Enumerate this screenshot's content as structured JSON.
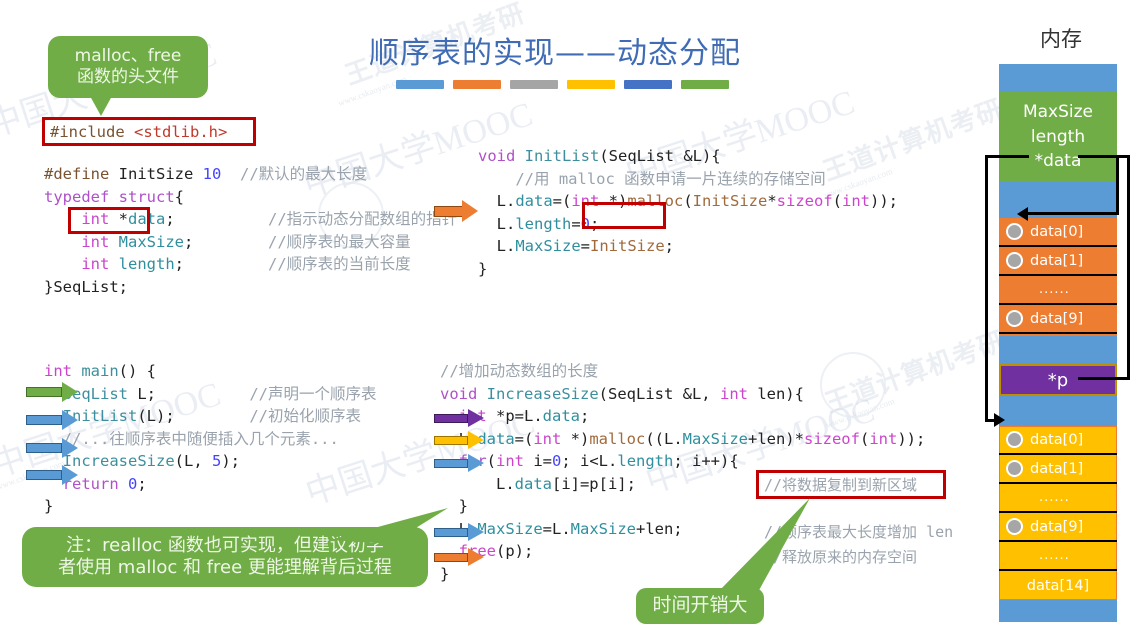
{
  "slide": {
    "title": "顺序表的实现——动态分配",
    "title_color": "#3f6cb4",
    "bar_colors": [
      "#5b9bd5",
      "#ed7d31",
      "#a5a5a5",
      "#ffc000",
      "#4472c4",
      "#70ad47"
    ]
  },
  "callouts": {
    "header_note": {
      "line1": "malloc、free",
      "line2": "函数的头文件"
    },
    "realloc_note": {
      "line1": "注：realloc 函数也可实现，但建议初学",
      "line2": "者使用 malloc 和 free 更能理解背后过程"
    },
    "time_cost": {
      "text": "时间开销大"
    }
  },
  "code": {
    "include": {
      "directive": "#include",
      "header": "<stdlib.h>"
    },
    "struct_block": [
      {
        "tokens": [
          {
            "t": "#define ",
            "c": "pp"
          },
          {
            "t": "InitSize ",
            "c": "pl"
          },
          {
            "t": "10",
            "c": "num"
          },
          {
            "t": "  ",
            "c": "pl"
          },
          {
            "t": "//默认的最大长度",
            "c": "cm"
          }
        ]
      },
      {
        "tokens": [
          {
            "t": "typedef",
            "c": "kw"
          },
          {
            "t": " ",
            "c": "pl"
          },
          {
            "t": "struct",
            "c": "kw"
          },
          {
            "t": "{",
            "c": "pl"
          }
        ]
      },
      {
        "tokens": [
          {
            "t": "    ",
            "c": "pl"
          },
          {
            "t": "int",
            "c": "kw2"
          },
          {
            "t": " *",
            "c": "pl"
          },
          {
            "t": "data",
            "c": "id"
          },
          {
            "t": ";",
            "c": "pl"
          },
          {
            "t": "          ",
            "c": "pl"
          },
          {
            "t": "//指示动态分配数组的指针",
            "c": "cm"
          }
        ]
      },
      {
        "tokens": [
          {
            "t": "    ",
            "c": "pl"
          },
          {
            "t": "int",
            "c": "kw2"
          },
          {
            "t": " ",
            "c": "pl"
          },
          {
            "t": "MaxSize",
            "c": "id"
          },
          {
            "t": ";",
            "c": "pl"
          },
          {
            "t": "        ",
            "c": "pl"
          },
          {
            "t": "//顺序表的最大容量",
            "c": "cm"
          }
        ]
      },
      {
        "tokens": [
          {
            "t": "    ",
            "c": "pl"
          },
          {
            "t": "int",
            "c": "kw2"
          },
          {
            "t": " ",
            "c": "pl"
          },
          {
            "t": "length",
            "c": "id"
          },
          {
            "t": ";",
            "c": "pl"
          },
          {
            "t": "         ",
            "c": "pl"
          },
          {
            "t": "//顺序表的当前长度",
            "c": "cm"
          }
        ]
      },
      {
        "tokens": [
          {
            "t": "}SeqList;",
            "c": "pl"
          }
        ]
      }
    ],
    "initlist_block": [
      {
        "tokens": [
          {
            "t": "void",
            "c": "kw"
          },
          {
            "t": " ",
            "c": "pl"
          },
          {
            "t": "InitList",
            "c": "fn"
          },
          {
            "t": "(SeqList &L){",
            "c": "pl"
          }
        ]
      },
      {
        "tokens": [
          {
            "t": "    ",
            "c": "pl"
          },
          {
            "t": "//用 malloc 函数申请一片连续的存储空间",
            "c": "cm"
          }
        ]
      },
      {
        "tokens": [
          {
            "t": "  L.",
            "c": "pl"
          },
          {
            "t": "data",
            "c": "id"
          },
          {
            "t": "=(",
            "c": "pl"
          },
          {
            "t": "int",
            "c": "kw2"
          },
          {
            "t": " *)",
            "c": "pl"
          },
          {
            "t": "malloc",
            "c": "ty"
          },
          {
            "t": "(",
            "c": "pl"
          },
          {
            "t": "InitSize",
            "c": "ty"
          },
          {
            "t": "*",
            "c": "pl"
          },
          {
            "t": "sizeof",
            "c": "kw2"
          },
          {
            "t": "(",
            "c": "pl"
          },
          {
            "t": "int",
            "c": "kw2"
          },
          {
            "t": "));",
            "c": "pl"
          }
        ]
      },
      {
        "tokens": [
          {
            "t": "  L.",
            "c": "pl"
          },
          {
            "t": "length",
            "c": "id"
          },
          {
            "t": "=",
            "c": "pl"
          },
          {
            "t": "0",
            "c": "num"
          },
          {
            "t": ";",
            "c": "pl"
          }
        ]
      },
      {
        "tokens": [
          {
            "t": "  L.",
            "c": "pl"
          },
          {
            "t": "MaxSize",
            "c": "id"
          },
          {
            "t": "=",
            "c": "pl"
          },
          {
            "t": "InitSize",
            "c": "ty"
          },
          {
            "t": ";",
            "c": "pl"
          }
        ]
      },
      {
        "tokens": [
          {
            "t": "}",
            "c": "pl"
          }
        ]
      }
    ],
    "main_block": [
      {
        "tokens": [
          {
            "t": "int",
            "c": "kw2"
          },
          {
            "t": " ",
            "c": "pl"
          },
          {
            "t": "main",
            "c": "fn"
          },
          {
            "t": "() {",
            "c": "pl"
          }
        ]
      },
      {
        "tokens": [
          {
            "t": "  ",
            "c": "pl"
          },
          {
            "t": "SeqList",
            "c": "fn"
          },
          {
            "t": " L;",
            "c": "pl"
          },
          {
            "t": "          ",
            "c": "pl"
          },
          {
            "t": "//声明一个顺序表",
            "c": "cm"
          }
        ]
      },
      {
        "tokens": [
          {
            "t": "  ",
            "c": "pl"
          },
          {
            "t": "InitList",
            "c": "fn"
          },
          {
            "t": "(L);",
            "c": "pl"
          },
          {
            "t": "        ",
            "c": "pl"
          },
          {
            "t": "//初始化顺序表",
            "c": "cm"
          }
        ]
      },
      {
        "tokens": [
          {
            "t": "  ",
            "c": "pl"
          },
          {
            "t": "//...往顺序表中随便插入几个元素...",
            "c": "cm"
          }
        ]
      },
      {
        "tokens": [
          {
            "t": "  ",
            "c": "pl"
          },
          {
            "t": "IncreaseSize",
            "c": "fn"
          },
          {
            "t": "(L, ",
            "c": "pl"
          },
          {
            "t": "5",
            "c": "num"
          },
          {
            "t": ");",
            "c": "pl"
          }
        ]
      },
      {
        "tokens": [
          {
            "t": "  ",
            "c": "pl"
          },
          {
            "t": "return",
            "c": "kw"
          },
          {
            "t": " ",
            "c": "pl"
          },
          {
            "t": "0",
            "c": "num"
          },
          {
            "t": ";",
            "c": "pl"
          }
        ]
      },
      {
        "tokens": [
          {
            "t": "}",
            "c": "pl"
          }
        ]
      }
    ],
    "increase_block": [
      {
        "tokens": [
          {
            "t": "//增加动态数组的长度",
            "c": "cm"
          }
        ]
      },
      {
        "tokens": [
          {
            "t": "void",
            "c": "kw"
          },
          {
            "t": " ",
            "c": "pl"
          },
          {
            "t": "IncreaseSize",
            "c": "fn"
          },
          {
            "t": "(SeqList &L, ",
            "c": "pl"
          },
          {
            "t": "int",
            "c": "kw2"
          },
          {
            "t": " len){",
            "c": "pl"
          }
        ]
      },
      {
        "tokens": [
          {
            "t": "  ",
            "c": "pl"
          },
          {
            "t": "int",
            "c": "kw2"
          },
          {
            "t": " *p=L.",
            "c": "pl"
          },
          {
            "t": "data",
            "c": "id"
          },
          {
            "t": ";",
            "c": "pl"
          }
        ]
      },
      {
        "tokens": [
          {
            "t": "  L.",
            "c": "pl"
          },
          {
            "t": "data",
            "c": "id"
          },
          {
            "t": "=(",
            "c": "pl"
          },
          {
            "t": "int",
            "c": "kw2"
          },
          {
            "t": " *)",
            "c": "pl"
          },
          {
            "t": "malloc",
            "c": "ty"
          },
          {
            "t": "((L.",
            "c": "pl"
          },
          {
            "t": "MaxSize",
            "c": "id"
          },
          {
            "t": "+len)*",
            "c": "pl"
          },
          {
            "t": "sizeof",
            "c": "kw2"
          },
          {
            "t": "(",
            "c": "pl"
          },
          {
            "t": "int",
            "c": "kw2"
          },
          {
            "t": "));",
            "c": "pl"
          }
        ]
      },
      {
        "tokens": [
          {
            "t": "  ",
            "c": "pl"
          },
          {
            "t": "for",
            "c": "kw"
          },
          {
            "t": "(",
            "c": "pl"
          },
          {
            "t": "int",
            "c": "kw2"
          },
          {
            "t": " i=",
            "c": "pl"
          },
          {
            "t": "0",
            "c": "num"
          },
          {
            "t": "; i<L.",
            "c": "pl"
          },
          {
            "t": "length",
            "c": "id"
          },
          {
            "t": "; i++){",
            "c": "pl"
          }
        ]
      },
      {
        "tokens": [
          {
            "t": "      L.",
            "c": "pl"
          },
          {
            "t": "data",
            "c": "id"
          },
          {
            "t": "[i]=p[i];",
            "c": "pl"
          }
        ]
      },
      {
        "tokens": [
          {
            "t": "  }",
            "c": "pl"
          }
        ]
      },
      {
        "tokens": [
          {
            "t": "  L.",
            "c": "pl"
          },
          {
            "t": "MaxSize",
            "c": "id"
          },
          {
            "t": "=L.",
            "c": "pl"
          },
          {
            "t": "MaxSize",
            "c": "id"
          },
          {
            "t": "+len;",
            "c": "pl"
          }
        ]
      },
      {
        "tokens": [
          {
            "t": "  ",
            "c": "pl"
          },
          {
            "t": "free",
            "c": "kw2"
          },
          {
            "t": "(p);",
            "c": "pl"
          }
        ]
      },
      {
        "tokens": [
          {
            "t": "}",
            "c": "pl"
          }
        ]
      }
    ],
    "side_comments": {
      "copy_data": "//将数据复制到新区域",
      "maxsize_grow": "//顺序表最大长度增加 len",
      "free_mem": "//释放原来的内存空间"
    }
  },
  "memory": {
    "heading": "内存",
    "struct_labels": [
      "MaxSize",
      "length",
      "*data"
    ],
    "pointer_label": "*p",
    "old_array": [
      "data[0]",
      "data[1]",
      "......",
      "data[9]"
    ],
    "new_array": [
      "data[0]",
      "data[1]",
      "......",
      "data[9]",
      "......",
      "data[14]"
    ],
    "colors": {
      "free_space": "#5b9bd5",
      "struct": "#70ad47",
      "old_array": "#ed7d31",
      "new_array": "#ffc000",
      "pointer": "#7030a0"
    }
  },
  "watermarks": {
    "brand": "王道计算机考研",
    "url": "www.cskaoyan.com",
    "mooc": "中国大学MOOC"
  }
}
